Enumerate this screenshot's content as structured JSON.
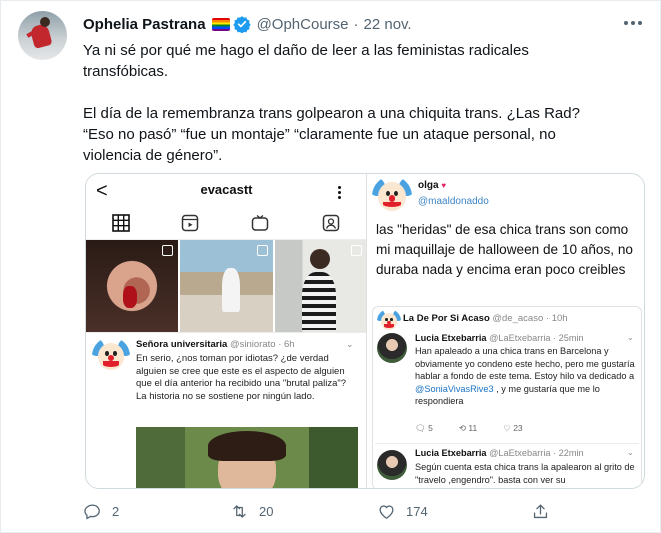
{
  "tweet": {
    "author_name": "Ophelia Pastrana",
    "handle": "@OphCourse",
    "separator": "·",
    "date": "22 nov.",
    "text_lines": [
      "Ya ni sé por qué me hago el daño de leer a las feministas radicales",
      "transfóbicas.",
      "",
      "El día de la remembranza trans golpearon a una chiquita trans. ¿Las Rad?",
      "“Eso no pasó” “fue un montaje” “claramente fue un ataque personal, no",
      "violencia de género”."
    ],
    "icons": {
      "more": "more-icon",
      "verified": "verified-badge-icon",
      "flag": "rainbow-flag-icon"
    }
  },
  "media": {
    "left": {
      "username": "evacastt",
      "back_glyph": "<",
      "tabs": [
        "grid-icon",
        "reels-icon",
        "igtv-icon",
        "tagged-icon"
      ],
      "post_author": "Señora universitaria",
      "post_handle_time": "@siniorato · 6h",
      "post_text": "En serio, ¿nos toman por idiotas? ¿de verdad alguien se cree que este es el aspecto de alguien que el día anterior ha recibido una \"brutal paliza\"? La historia no se sostiene por ningún lado."
    },
    "right": {
      "author": "olga",
      "heart": "♥",
      "handle": "@maaldonaddo",
      "text": "las \"heridas\" de esa chica trans son como mi maquillaje de halloween de 10 años, no duraba nada y encima eran poco creibles",
      "quote_author": "La De Por Si Acaso",
      "quote_handle_time": "@de_acaso · 10h",
      "posts": [
        {
          "name": "Lucia Etxebarria",
          "handle_time": "@LaEtxebarria · 25min",
          "text_before": "Han apaleado a una chica trans en Barcelona y obviamente yo condeno este hecho, pero me gustaría hablar a fondo de este tema. Estoy hilo va dedicado a ",
          "link": "@SoniaVivasRive3",
          "text_after": " , y me gustaría que me lo respondiera",
          "replies": "5",
          "retweets": "11",
          "likes": "23"
        },
        {
          "name": "Lucia Etxebarria",
          "handle_time": "@LaEtxebarria · 22min",
          "text": "Según cuenta esta chica trans la apalearon al grito de \"travelo ,engendro\". basta con ver su"
        }
      ]
    }
  },
  "actions": {
    "reply_count": "2",
    "retweet_count": "20",
    "like_count": "174"
  }
}
